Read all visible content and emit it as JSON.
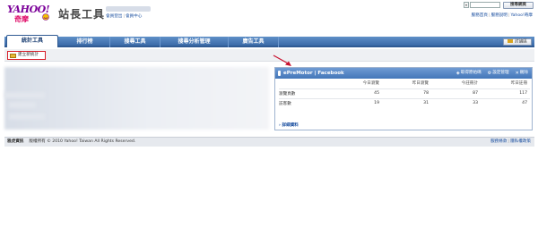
{
  "header": {
    "logo_text": "YAHOO!",
    "logo_sub": "奇摩",
    "site_title": "站長工具",
    "user_links": [
      "會員登出",
      "會員中心"
    ]
  },
  "topbar": {
    "search_select": "▾",
    "search_button": "搜尋網頁",
    "links": [
      "服務首頁",
      "服務說明",
      "Yahoo!奇摩"
    ]
  },
  "nav": {
    "tabs": [
      "統計工具",
      "排行榜",
      "搜尋工具",
      "搜尋分析管理",
      "廣告工具"
    ],
    "feedback": "討論區"
  },
  "toolbar": {
    "new_stat": "建立新統計"
  },
  "panel": {
    "title": "ePreMotor | Facebook",
    "actions": [
      "取得原始碼",
      "設定管理",
      "刪除"
    ],
    "columns": [
      "今日瀏覽",
      "昨日瀏覽",
      "今註冊計",
      "昨日註冊"
    ],
    "rows": [
      {
        "label": "瀏覽頁數",
        "values": [
          "45",
          "78",
          "87",
          "117"
        ]
      },
      {
        "label": "訪客數",
        "values": [
          "19",
          "31",
          "33",
          "47"
        ]
      }
    ],
    "details_link": "詳細資料"
  },
  "footer": {
    "company": "雅虎資訊",
    "copyright": "版權所有 © 2010 Yahoo! Taiwan All Rights Reserved.",
    "links": [
      "服務條款",
      "隱私權政策"
    ]
  }
}
